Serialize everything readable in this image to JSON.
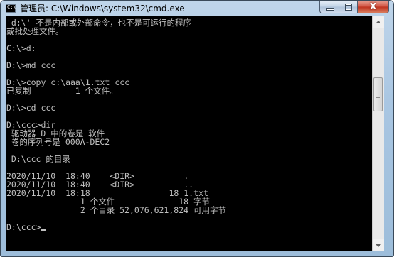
{
  "window": {
    "title": "管理员: C:\\Windows\\system32\\cmd.exe",
    "icon": "cmd-icon",
    "icon_text": "C:\\"
  },
  "caption": {
    "close_glyph": "X"
  },
  "console": {
    "lines": [
      "'d:\\' 不是内部或外部命令，也不是可运行的程序",
      "或批处理文件。",
      "",
      "C:\\>d:",
      "",
      "D:\\>md ccc",
      "",
      "D:\\>copy c:\\aaa\\1.txt ccc",
      "已复制         1 个文件。",
      "",
      "D:\\>cd ccc",
      "",
      "D:\\ccc>dir",
      " 驱动器 D 中的卷是 软件",
      " 卷的序列号是 000A-DEC2",
      "",
      " D:\\ccc 的目录",
      "",
      "2020/11/10  18:40    <DIR>          .",
      "2020/11/10  18:40    <DIR>          ..",
      "2020/11/10  18:18                18 1.txt",
      "               1 个文件             18 字节",
      "               2 个目录 52,076,621,824 可用字节",
      "",
      "D:\\ccc>"
    ]
  }
}
